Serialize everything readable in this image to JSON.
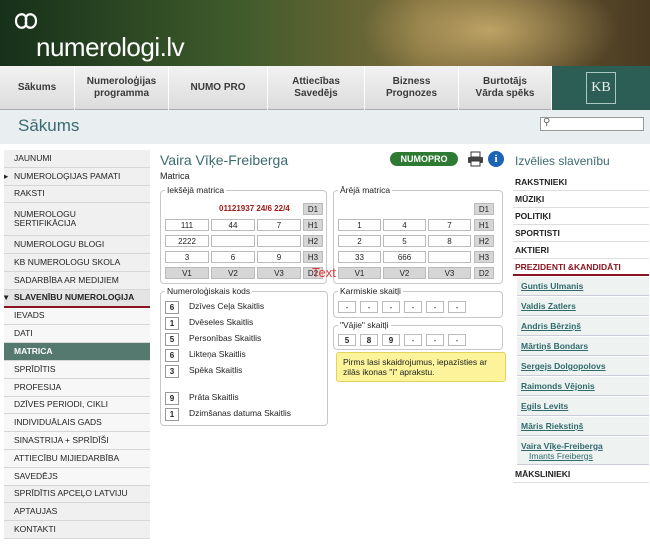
{
  "site": {
    "logo": "numerologi.lv",
    "badge": "KB"
  },
  "nav": [
    "Sākums",
    "Numeroloģijas\nprogramma",
    "NUMO PRO",
    "Attiecības\nSavedējs",
    "Bizness\nPrognozes",
    "Burtotājs\nVārda spēks"
  ],
  "page_title": "Sākums",
  "search_placeholder": "",
  "sidebar": [
    "JAUNUMI",
    "NUMEROLOĢIJAS PAMATI",
    "RAKSTI",
    "NUMEROLOGU\nSERTIFIKĀCIJA",
    "NUMEROLOGU BLOGI",
    "KB NUMEROLOGU SKOLA",
    "SADARBĪBA AR MEDIJIEM",
    "SLAVENĪBU NUMEROLOĢIJA",
    "IEVADS",
    "DATI",
    "MATRICA",
    "SPRĪDĪTIS",
    "PROFESIJA",
    "DZĪVES PERIODI, CIKLI",
    "INDIVIDUĀLAIS GADS",
    "SINASTRIJA + SPRĪDĪŠI",
    "ATTIECĪBU MIJIEDARBĪBA",
    "SAVEDĒJS",
    "SPRĪDĪTIS APCEĻO LATVIJU",
    "APTAUJAS",
    "KONTAKTI"
  ],
  "main": {
    "name": "Vaira Vīķe-Freiberga",
    "numopro": "NUMOPRO",
    "info": "i",
    "matrica": "Matrica",
    "inner": {
      "legend": "Iekšējā matrica",
      "date": "01121937 24/6 22/4",
      "rows": [
        [
          "111",
          "44",
          "7"
        ],
        [
          "2222",
          "",
          ""
        ],
        [
          "3",
          "6",
          "9"
        ]
      ],
      "heads": [
        "D1",
        "H1",
        "H2",
        "H3",
        "D2"
      ],
      "v": [
        "V1",
        "V2",
        "V3"
      ]
    },
    "outer": {
      "legend": "Ārējā matrica",
      "rows": [
        [
          "1",
          "4",
          "7"
        ],
        [
          "2",
          "5",
          "8"
        ],
        [
          "33",
          "666",
          ""
        ]
      ]
    },
    "kods": {
      "legend": "Numeroloģiskais kods",
      "items": [
        {
          "n": "6",
          "l": "Dzīves Ceļa Skaitlis"
        },
        {
          "n": "1",
          "l": "Dvēseles Skaitlis"
        },
        {
          "n": "5",
          "l": "Personības Skaitlis"
        },
        {
          "n": "6",
          "l": "Likteņa Skaitlis"
        },
        {
          "n": "3",
          "l": "Spēka Skaitlis"
        },
        {
          "n": "9",
          "l": "Prāta Skaitlis"
        },
        {
          "n": "1",
          "l": "Dzimšanas datuma Skaitlis"
        }
      ]
    },
    "karm": {
      "legend": "Karmiskie skaitļi",
      "vals": [
        "-",
        "-",
        "-",
        "-",
        "-",
        "-"
      ]
    },
    "vaj": {
      "legend": "\"Vājie\" skaitļi",
      "vals": [
        "5",
        "8",
        "9",
        "-",
        "-",
        "-"
      ]
    },
    "notice": "Pirms lasi skaidrojumus, iepazīsties ar zilās ikonas \"i\" aprakstu.",
    "overlay": "Text"
  },
  "right": {
    "header": "Izvēlies slavenību",
    "cats": [
      "RAKSTNIEKI",
      "MŪZIĶI",
      "POLITIĶI",
      "SPORTISTI",
      "AKTIERI",
      "PREZIDENTI &KANDIDĀTI"
    ],
    "people": [
      "Guntis Ulmanis",
      "Valdis Zatlers",
      "Andris Bērziņš",
      "Mārtiņš Bondars",
      "Sergejs Dolgopolovs",
      "Raimonds Vējonis",
      "Egils Levits",
      "Māris Riekstiņš"
    ],
    "selected": "Vaira Vīķe-Freiberga",
    "selected_sub": "Imants Freibergs",
    "last": "MĀKSLINIEKI"
  }
}
